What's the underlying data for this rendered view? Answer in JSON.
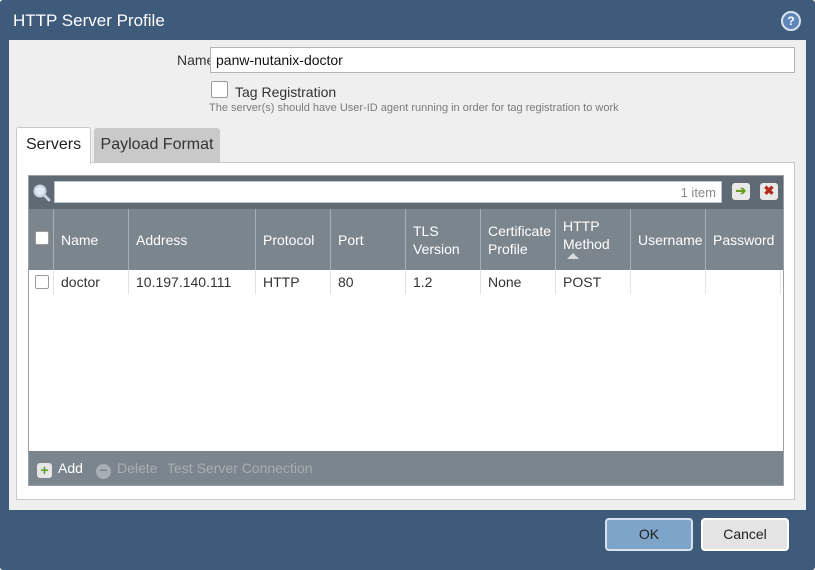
{
  "dialog": {
    "title": "HTTP Server Profile",
    "help_glyph": "?"
  },
  "form": {
    "name_label": "Name",
    "name_value": "panw-nutanix-doctor",
    "tag_registration_label": "Tag Registration",
    "tag_registration_checked": false,
    "tag_hint": "The server(s) should have User-ID agent running in order for tag registration to work"
  },
  "tabs": [
    {
      "label": "Servers",
      "active": true
    },
    {
      "label": "Payload Format",
      "active": false
    }
  ],
  "grid": {
    "search_placeholder": "",
    "item_count": "1 item",
    "go_glyph": "➔",
    "clear_glyph": "✖",
    "columns": [
      "Name",
      "Address",
      "Protocol",
      "Port",
      "TLS Version",
      "Certificate Profile",
      "HTTP Method",
      "Username",
      "Password"
    ],
    "sorted_column": "HTTP Method",
    "sort_direction": "ascending",
    "rows": [
      {
        "checked": false,
        "cells": [
          "doctor",
          "10.197.140.111",
          "HTTP",
          "80",
          "1.2",
          "None",
          "POST",
          "",
          ""
        ]
      }
    ],
    "footer": {
      "add_label": "Add",
      "delete_label": "Delete",
      "test_label": "Test Server Connection"
    }
  },
  "buttons": {
    "ok_label": "OK",
    "cancel_label": "Cancel"
  },
  "colors": {
    "titlebar": "#3f5b7c",
    "grid_header": "#7b858e",
    "ok_button": "#7ea4c9"
  }
}
